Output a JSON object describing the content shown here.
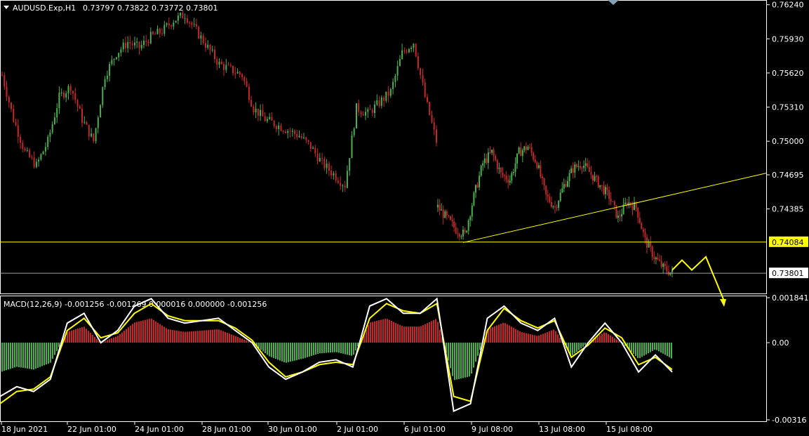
{
  "header": {
    "symbol": "AUDUSD.Exp,H1",
    "ohlc": "0.73797 0.73822 0.73772 0.73801"
  },
  "macd_header": "MACD(12,26,9) -0.001256 -0.001269 0.000016 0.000000 -0.001256",
  "colors": {
    "background": "#000000",
    "bull": "#4caf50",
    "bear": "#c62828",
    "grid_border": "#ffffff",
    "level_line": "#ffff00",
    "macd_line": "#ffffff",
    "signal_line": "#ffff00"
  },
  "chart_data": [
    {
      "type": "candlestick",
      "title": "AUDUSD.Exp,H1",
      "ylim": [
        0.7363,
        0.7627
      ],
      "y_ticks": [
        "0.76240",
        "0.75930",
        "0.75620",
        "0.75310",
        "0.75000",
        "0.74695",
        "0.74385"
      ],
      "horizontal_line": {
        "value": 0.74084,
        "label": "0.74084"
      },
      "current_price": {
        "value": 0.73801,
        "label": "0.73801"
      },
      "trendline": {
        "from": 0.7408,
        "to": 0.7471
      },
      "close_path": [
        0.756,
        0.752,
        0.749,
        0.7478,
        0.75,
        0.754,
        0.755,
        0.752,
        0.75,
        0.756,
        0.758,
        0.759,
        0.7585,
        0.7595,
        0.76,
        0.761,
        0.7615,
        0.76,
        0.7585,
        0.757,
        0.7565,
        0.756,
        0.753,
        0.752,
        0.7515,
        0.751,
        0.7505,
        0.7495,
        0.748,
        0.747,
        0.746,
        0.753,
        0.7525,
        0.7535,
        0.7545,
        0.758,
        0.759,
        0.754,
        0.75
      ],
      "close_path_2": [
        0.744,
        0.743,
        0.742,
        0.7415,
        0.745,
        0.748,
        0.749,
        0.747,
        0.7465,
        0.749,
        0.7495,
        0.748,
        0.745,
        0.744,
        0.746,
        0.7475,
        0.748,
        0.747,
        0.746,
        0.745,
        0.743,
        0.7445,
        0.744,
        0.741,
        0.7395,
        0.7385,
        0.738
      ],
      "arrows": "projected-path"
    },
    {
      "type": "line",
      "title": "MACD(12,26,9)",
      "ylim": [
        -0.00316,
        0.001841
      ],
      "y_ticks": [
        "0.001841",
        "0.00",
        "-0.00316"
      ],
      "series": [
        {
          "values": [
            -0.0022,
            -0.0018,
            -0.002,
            -0.0015,
            0.0008,
            0.0012,
            0.0,
            0.0005,
            0.0015,
            0.0018,
            0.001,
            0.0008,
            0.0009,
            0.001,
            0.0005,
            0.0,
            -0.001,
            -0.0015,
            -0.0012,
            -0.0008,
            -0.0007,
            -0.001,
            0.0015,
            0.0018,
            0.0012,
            0.0012,
            0.0018,
            -0.0028,
            -0.0025,
            0.001,
            0.0015,
            0.0008,
            0.0005,
            0.001,
            -0.001,
            0.0,
            0.0008,
            0.0,
            -0.0012,
            -0.0005,
            -0.0012
          ]
        },
        {
          "values": [
            -0.0025,
            -0.002,
            -0.0019,
            -0.0014,
            0.0005,
            0.001,
            0.0002,
            0.0004,
            0.0012,
            0.0016,
            0.0011,
            0.0009,
            0.0009,
            0.0009,
            0.0006,
            0.0001,
            -0.0008,
            -0.0014,
            -0.0012,
            -0.0009,
            -0.0008,
            -0.0009,
            0.001,
            0.0016,
            0.0013,
            0.0012,
            0.0016,
            -0.0022,
            -0.0024,
            0.0005,
            0.0014,
            0.0009,
            0.0006,
            0.0009,
            -0.0006,
            -0.0001,
            0.0006,
            0.0002,
            -0.0009,
            -0.0006,
            -0.0011
          ]
        }
      ]
    }
  ],
  "x_ticks": [
    "18 Jun 2021",
    "22 Jun 01:00",
    "24 Jun 01:00",
    "28 Jun 01:00",
    "30 Jun 01:00",
    "2 Jul 01:00",
    "6 Jul 01:00",
    "9 Jul 08:00",
    "13 Jul 08:00",
    "15 Jul 08:00"
  ]
}
